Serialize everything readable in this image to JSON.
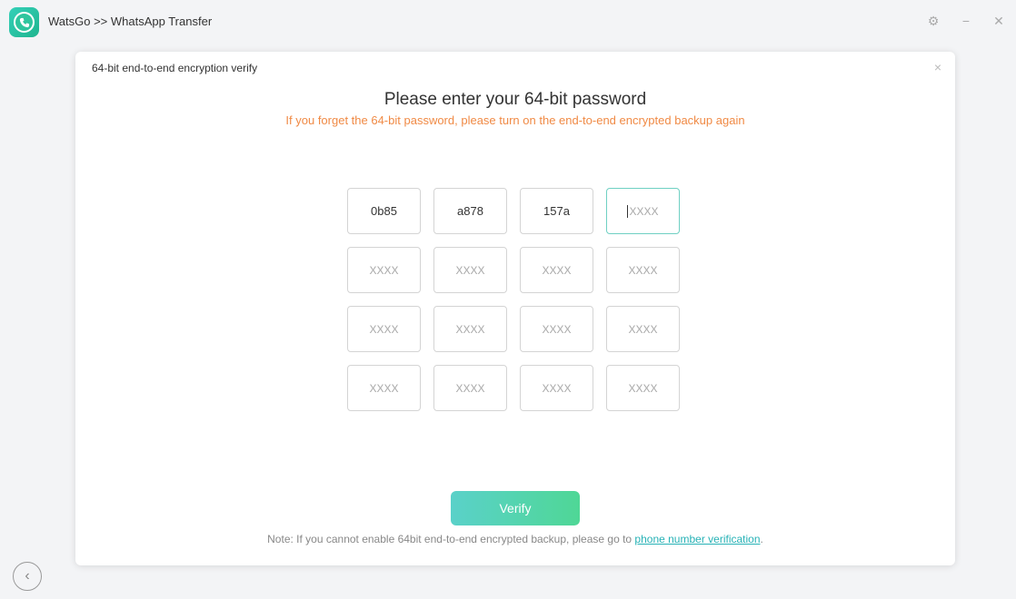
{
  "app": {
    "title": "WatsGo >> WhatsApp Transfer",
    "logo_icon": "whatsapp-transfer-logo-icon"
  },
  "window_controls": {
    "settings_glyph": "⚙",
    "minimize_glyph": "−",
    "close_glyph": "✕"
  },
  "dialog": {
    "title": "64-bit end-to-end encryption verify",
    "close_glyph": "×",
    "heading": "Please enter your 64-bit password",
    "subheading": "If you forget the 64-bit password, please turn on the end-to-end encrypted backup again",
    "placeholder": "XXXX",
    "cells": [
      "0b85",
      "a878",
      "157a",
      "",
      "",
      "",
      "",
      "",
      "",
      "",
      "",
      "",
      "",
      "",
      "",
      ""
    ],
    "active_cell_index": 3,
    "verify_label": "Verify",
    "note_prefix": "Note: If you cannot enable 64bit end-to-end encrypted backup, please go to ",
    "note_link": "phone number verification",
    "note_suffix": "."
  },
  "back_glyph": "‹",
  "colors": {
    "accent_orange": "#f08a45",
    "accent_teal": "#27b2b6",
    "button_gradient_start": "#5ad1c9",
    "button_gradient_end": "#4fd796"
  }
}
